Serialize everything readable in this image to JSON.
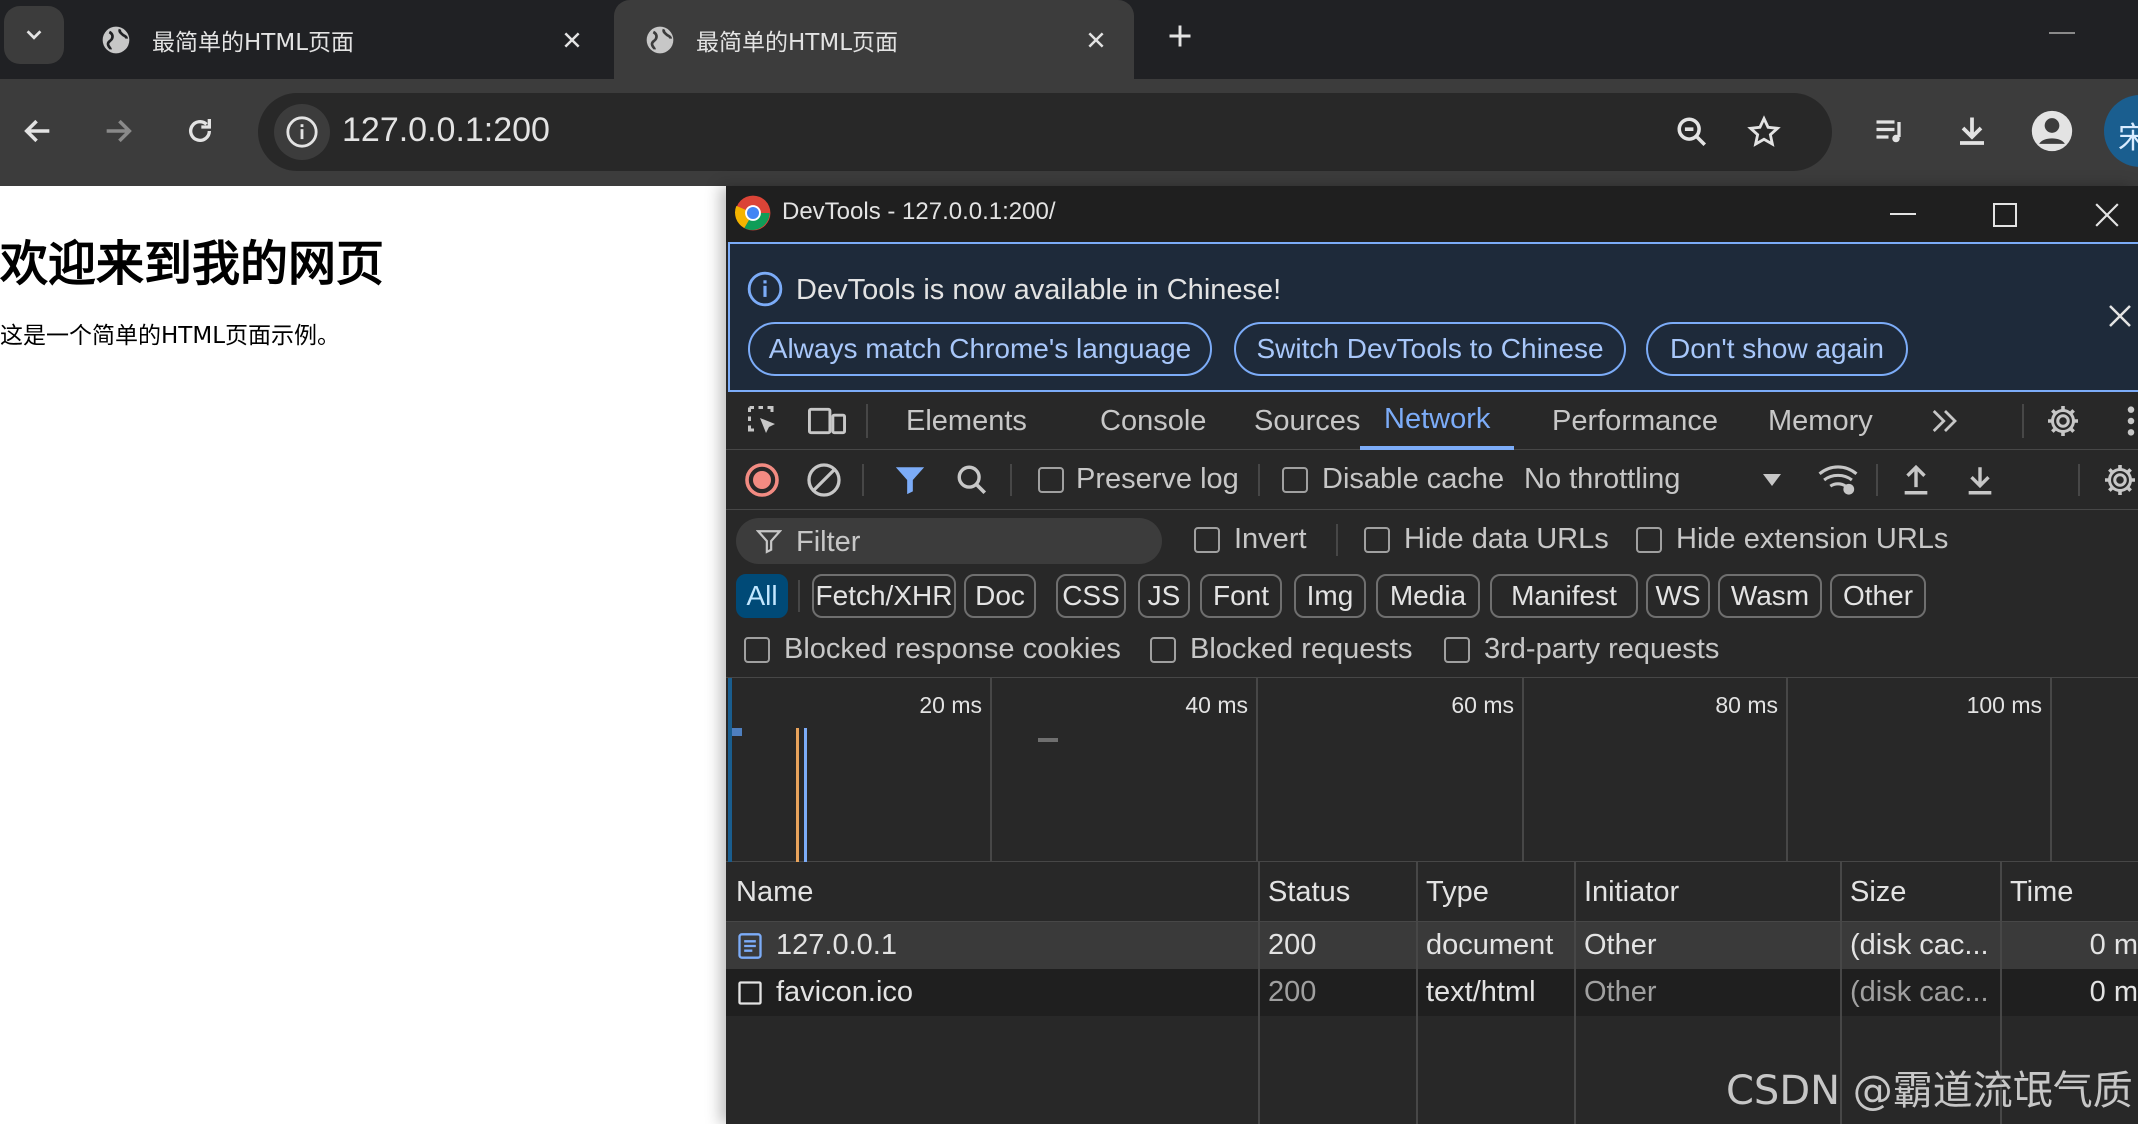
{
  "browser": {
    "tabs": [
      {
        "title": "最简单的HTML页面",
        "icon": "globe-icon"
      },
      {
        "title": "最简单的HTML页面",
        "icon": "globe-icon"
      }
    ],
    "url": "127.0.0.1:200",
    "profile_initial": "宋"
  },
  "page": {
    "heading": "欢迎来到我的网页",
    "paragraph": "这是一个简单的HTML页面示例。"
  },
  "devtools": {
    "window_title": "DevTools - 127.0.0.1:200/",
    "infobar": {
      "message": "DevTools is now available in Chinese!",
      "buttons": [
        "Always match Chrome's language",
        "Switch DevTools to Chinese",
        "Don't show again"
      ]
    },
    "panel_tabs": [
      "Elements",
      "Console",
      "Sources",
      "Network",
      "Performance",
      "Memory"
    ],
    "active_panel": "Network",
    "toolbar": {
      "preserve_log": "Preserve log",
      "disable_cache": "Disable cache",
      "throttling": "No throttling"
    },
    "filter": {
      "placeholder": "Filter",
      "invert": "Invert",
      "hide_data_urls": "Hide data URLs",
      "hide_extension_urls": "Hide extension URLs"
    },
    "type_filters": [
      "All",
      "Fetch/XHR",
      "Doc",
      "CSS",
      "JS",
      "Font",
      "Img",
      "Media",
      "Manifest",
      "WS",
      "Wasm",
      "Other"
    ],
    "active_type": "All",
    "more_filters": [
      "Blocked response cookies",
      "Blocked requests",
      "3rd-party requests"
    ],
    "timeline_labels": [
      "20 ms",
      "40 ms",
      "60 ms",
      "80 ms",
      "100 ms"
    ],
    "table": {
      "columns": [
        "Name",
        "Status",
        "Type",
        "Initiator",
        "Size",
        "Time"
      ],
      "rows": [
        {
          "name": "127.0.0.1",
          "status": "200",
          "type": "document",
          "initiator": "Other",
          "size": "(disk cac...",
          "time": "0 m"
        },
        {
          "name": "favicon.ico",
          "status": "200",
          "type": "text/html",
          "initiator": "Other",
          "size": "(disk cac...",
          "time": "0 m"
        }
      ]
    }
  },
  "watermark": "CSDN @霸道流氓气质",
  "colors": {
    "accent": "#7cacf8",
    "record": "#f28b82",
    "chip_active": "#004a77"
  }
}
